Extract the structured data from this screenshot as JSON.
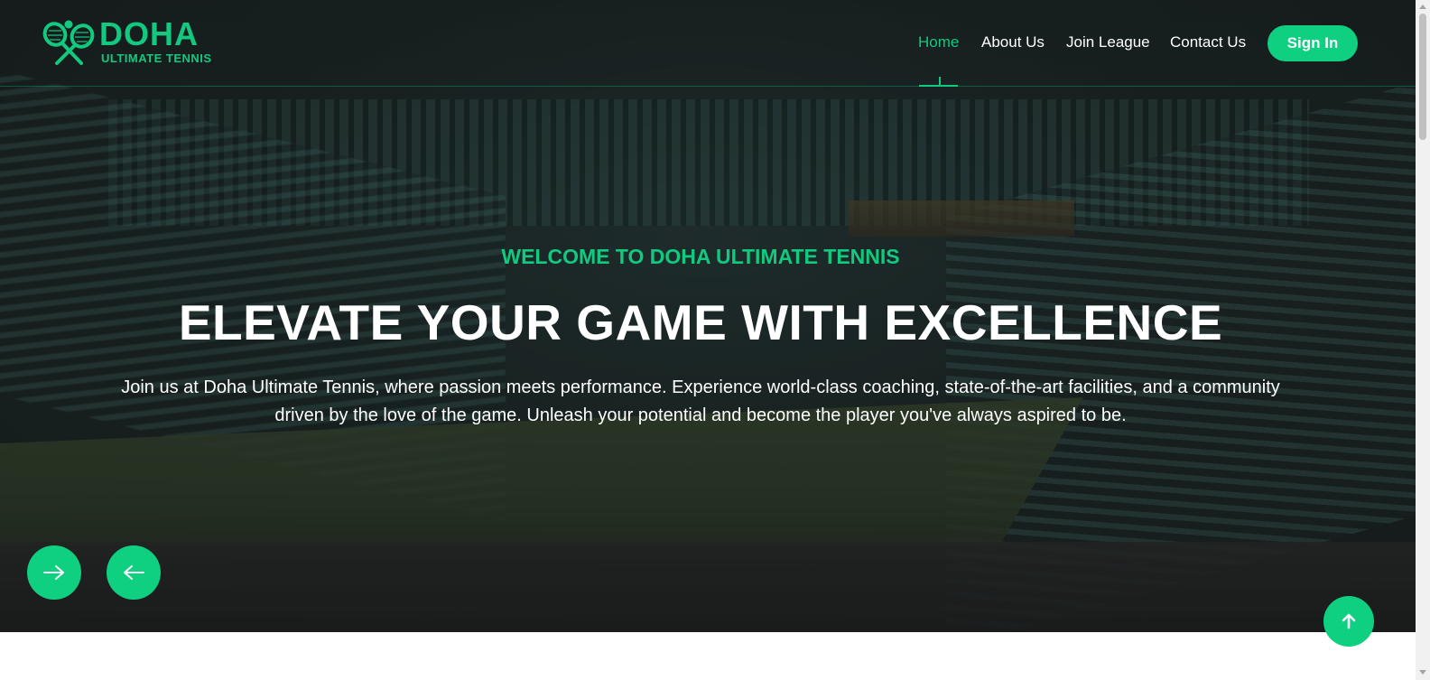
{
  "brand": {
    "name": "DOHA",
    "tagline": "ULTIMATE TENNIS",
    "logo_icon": "crossed-rackets-icon",
    "accent_color": "#11c97f"
  },
  "nav": {
    "items": [
      {
        "label": "Home",
        "active": true
      },
      {
        "label": "About Us",
        "active": false
      },
      {
        "label": "Join League",
        "active": false
      },
      {
        "label": "Contact Us",
        "active": false
      }
    ],
    "signin_label": "Sign In"
  },
  "hero": {
    "eyebrow": "WELCOME TO DOHA ULTIMATE TENNIS",
    "headline": "ELEVATE YOUR GAME WITH EXCELLENCE",
    "lead": "Join us at Doha Ultimate Tennis, where passion meets performance. Experience world-class coaching, state-of-the-art facilities, and a community driven by the love of the game. Unleash your potential and become the player you've always aspired to be.",
    "background": "tennis-stadium-photo"
  },
  "controls": {
    "next_icon": "arrow-right-icon",
    "prev_icon": "arrow-left-icon",
    "back_to_top_icon": "arrow-up-icon"
  }
}
